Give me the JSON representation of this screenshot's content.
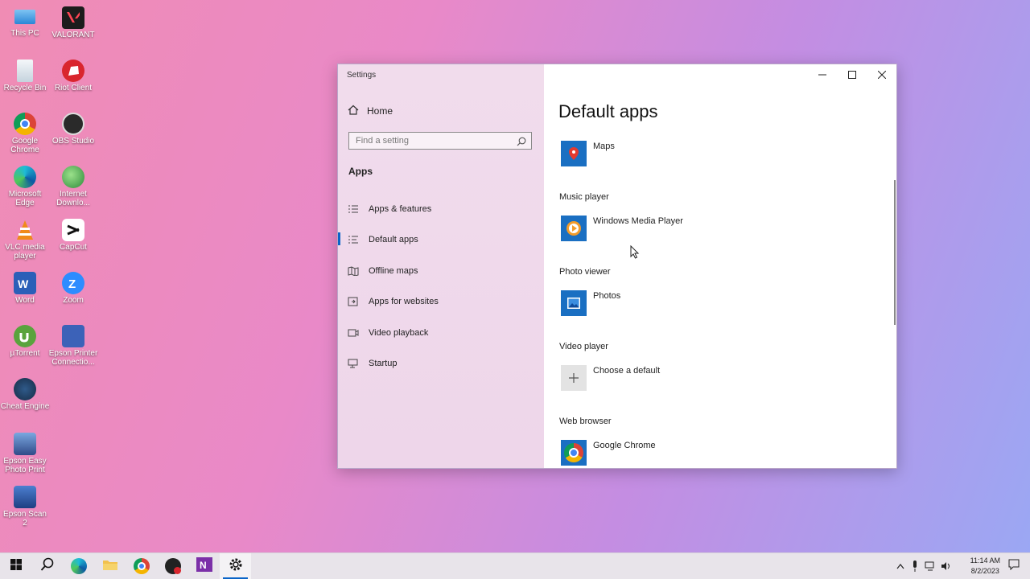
{
  "desktop": {
    "icons": [
      {
        "label": "This PC"
      },
      {
        "label": "VALORANT"
      },
      {
        "label": "Recycle Bin"
      },
      {
        "label": "Riot Client"
      },
      {
        "label": "Google Chrome"
      },
      {
        "label": "OBS Studio"
      },
      {
        "label": "Microsoft Edge"
      },
      {
        "label": "Internet Downlo..."
      },
      {
        "label": "VLC media player"
      },
      {
        "label": "CapCut"
      },
      {
        "label": "Word"
      },
      {
        "label": "Zoom"
      },
      {
        "label": "µTorrent"
      },
      {
        "label": "Epson Printer Connectio..."
      },
      {
        "label": "Cheat Engine"
      },
      {
        "label": "Epson Easy Photo Print"
      },
      {
        "label": "Epson Scan 2"
      }
    ]
  },
  "window": {
    "title": "Settings",
    "nav": {
      "home_label": "Home",
      "search_placeholder": "Find a setting",
      "section": "Apps",
      "items": [
        {
          "label": "Apps & features"
        },
        {
          "label": "Default apps"
        },
        {
          "label": "Offline maps"
        },
        {
          "label": "Apps for websites"
        },
        {
          "label": "Video playback"
        },
        {
          "label": "Startup"
        }
      ]
    },
    "content": {
      "title": "Default apps",
      "maps_app": "Maps",
      "music_label": "Music player",
      "music_app": "Windows Media Player",
      "photo_label": "Photo viewer",
      "photo_app": "Photos",
      "video_label": "Video player",
      "video_app": "Choose a default",
      "web_label": "Web browser",
      "web_app": "Google Chrome"
    }
  },
  "taskbar": {
    "time": "11:14 AM",
    "date": "8/2/2023"
  },
  "colors": {
    "accent": "#0a64c8",
    "nav_bg": "#f1dcec",
    "desktop_gradient": [
      "#f08cb4",
      "#c48de2",
      "#9aa8f4"
    ]
  }
}
